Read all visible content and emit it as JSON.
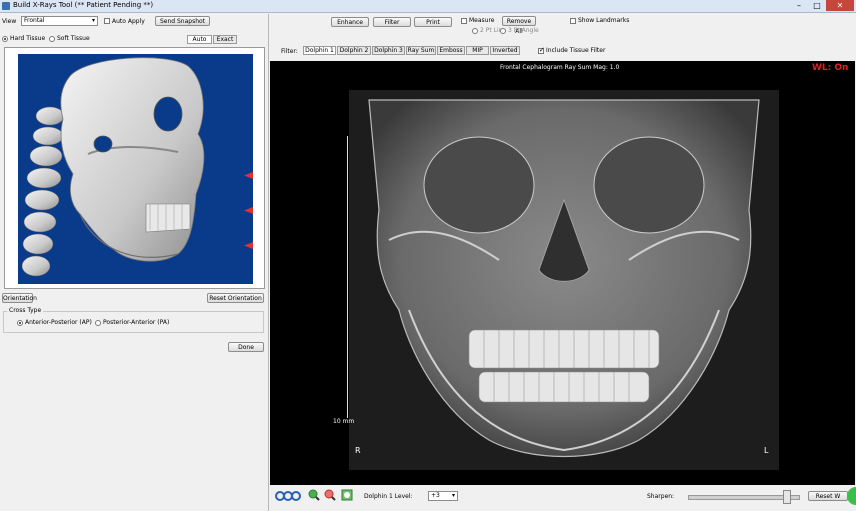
{
  "window": {
    "title": "Build X-Rays Tool   (** Patient Pending **)",
    "minimize": "–",
    "maximize": "□",
    "close": "✕"
  },
  "left": {
    "view_label": "View",
    "view_value": "Frontal",
    "auto_apply": "Auto Apply",
    "send_snapshot": "Send Snapshot",
    "hard_tissue": "Hard Tissue",
    "soft_tissue": "Soft Tissue",
    "tab_auto": "Auto",
    "tab_exact": "Exact",
    "orientation": "Orientation",
    "reset_orientation": "Reset Orientation",
    "group_label": "Cross Type",
    "ap": "Anterior-Posterior (AP)",
    "pa": "Posterior-Anterior (PA)",
    "done": "Done"
  },
  "top": {
    "btn1": "Enhance",
    "btn2": "Filter",
    "btn3": "Print",
    "measure": "Measure",
    "measure_value": "Remove All",
    "show_landmarks": "Show Landmarks",
    "sub1": "2 Pt Line",
    "sub2": "3 Pt Angle"
  },
  "filters": {
    "label": "Filter:",
    "tabs": [
      "Dolphin 1",
      "Dolphin 2",
      "Dolphin 3",
      "Ray Sum",
      "Emboss",
      "MIP",
      "Inverted"
    ],
    "include_tissue": "Include Tissue Filter"
  },
  "image": {
    "header": "Frontal Cephalogram  Ray Sum Mag: 1.0",
    "wl": "WL: On",
    "scale": "10 mm",
    "right": "R",
    "left": "L"
  },
  "bottom": {
    "level_label": "Dolphin 1 Level:",
    "level_value": "+3",
    "sharpen": "Sharpen:",
    "reset": "Reset W"
  }
}
